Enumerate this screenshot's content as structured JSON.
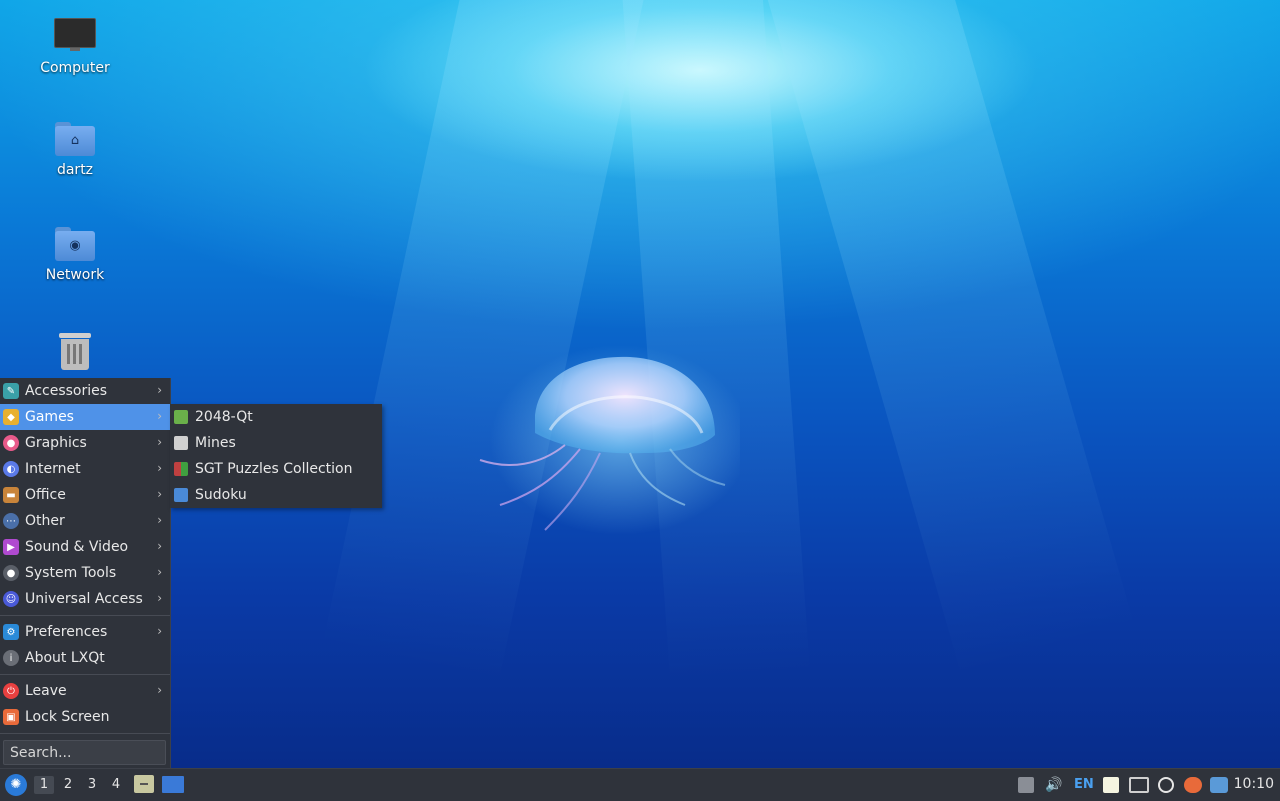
{
  "desktop": {
    "icons": [
      {
        "label": "Computer",
        "icon": "monitor-icon"
      },
      {
        "label": "dartz",
        "icon": "home-folder-icon"
      },
      {
        "label": "Network",
        "icon": "network-folder-icon"
      },
      {
        "label": "",
        "icon": "trash-icon"
      }
    ]
  },
  "menu": {
    "items": [
      {
        "label": "Accessories",
        "icon": "accessories-icon",
        "submenu": true,
        "color": "#3aa0a8"
      },
      {
        "label": "Games",
        "icon": "games-icon",
        "submenu": true,
        "active": true,
        "color": "#e8b030"
      },
      {
        "label": "Graphics",
        "icon": "graphics-icon",
        "submenu": true,
        "color": "#e85a8a"
      },
      {
        "label": "Internet",
        "icon": "internet-icon",
        "submenu": true,
        "color": "#5a7ae8"
      },
      {
        "label": "Office",
        "icon": "office-icon",
        "submenu": true,
        "color": "#c8843a"
      },
      {
        "label": "Other",
        "icon": "other-icon",
        "submenu": true,
        "color": "#4a6fa8"
      },
      {
        "label": "Sound & Video",
        "icon": "sound-video-icon",
        "submenu": true,
        "color": "#b04ad0"
      },
      {
        "label": "System Tools",
        "icon": "system-tools-icon",
        "submenu": true,
        "color": "#5a5f68"
      },
      {
        "label": "Universal Access",
        "icon": "universal-access-icon",
        "submenu": true,
        "color": "#4a5ad8"
      },
      {
        "label": "Preferences",
        "icon": "preferences-icon",
        "submenu": true,
        "color": "#2a8ad8"
      },
      {
        "label": "About LXQt",
        "icon": "info-icon",
        "submenu": false,
        "color": "#6a6e76"
      },
      {
        "label": "Leave",
        "icon": "power-icon",
        "submenu": true,
        "color": "#e84040"
      },
      {
        "label": "Lock Screen",
        "icon": "lock-icon",
        "submenu": false,
        "color": "#e86a3a"
      }
    ],
    "search_placeholder": "Search..."
  },
  "submenu": {
    "items": [
      {
        "label": "2048-Qt",
        "icon": "game-2048-icon",
        "color": "#6ab04a"
      },
      {
        "label": "Mines",
        "icon": "mines-icon",
        "color": "#d0d0d0"
      },
      {
        "label": "SGT Puzzles Collection",
        "icon": "puzzles-icon",
        "color": "#a0a0a0"
      },
      {
        "label": "Sudoku",
        "icon": "sudoku-icon",
        "color": "#4a8ad8"
      }
    ]
  },
  "taskbar": {
    "workspaces": [
      "1",
      "2",
      "3",
      "4"
    ],
    "current_workspace": "1",
    "keyboard_layout": "EN",
    "clock": "10:10"
  }
}
